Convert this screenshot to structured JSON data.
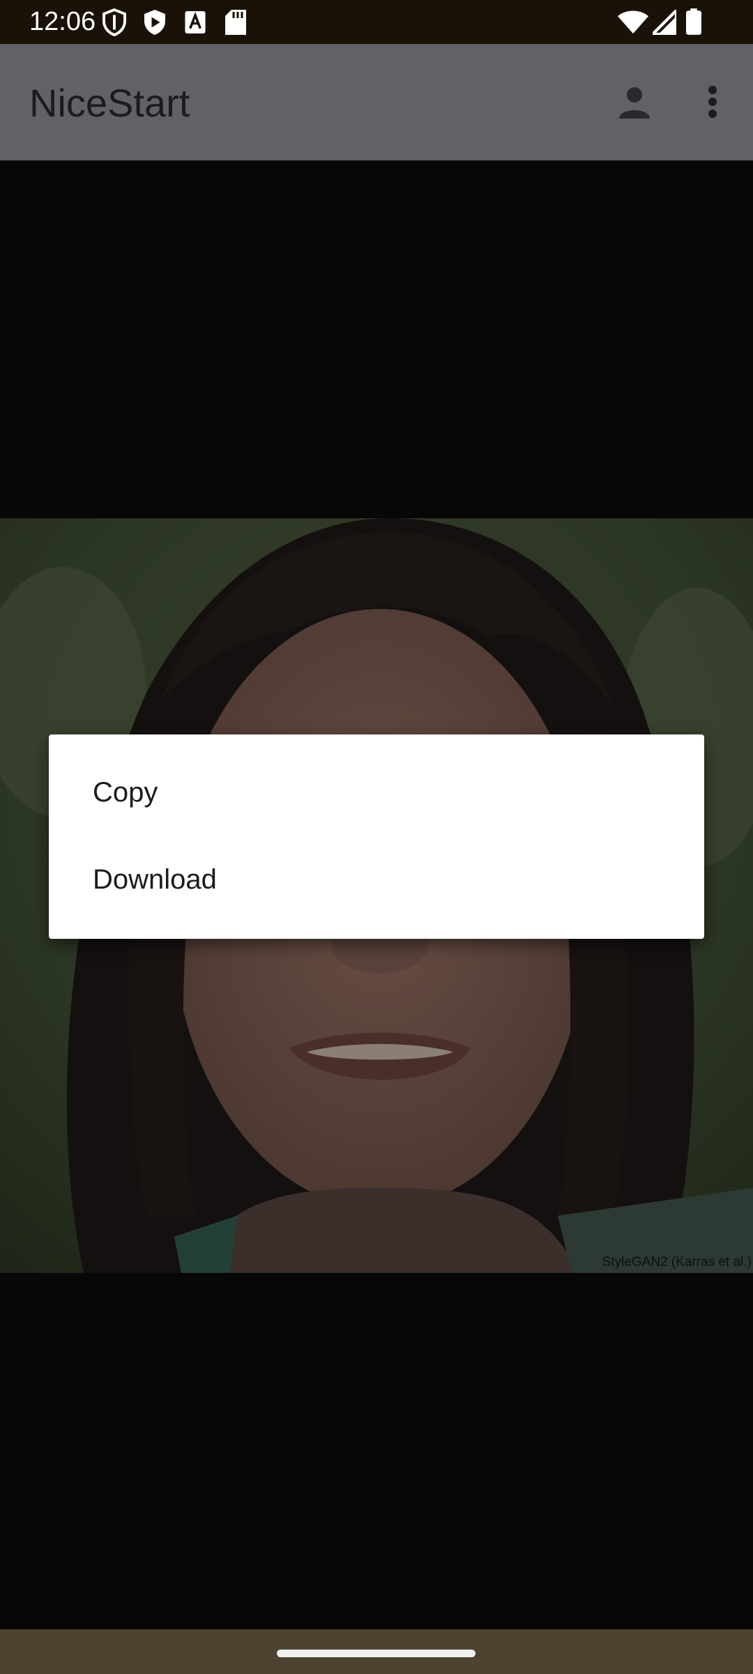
{
  "status_bar": {
    "time": "12:06",
    "left_icons": [
      "shield-icon",
      "play-protect-icon",
      "font-a-icon",
      "sd-card-icon"
    ],
    "right_icons": [
      "wifi-icon",
      "signal-icon",
      "battery-icon"
    ]
  },
  "app_bar": {
    "title": "NiceStart",
    "actions": [
      "account-icon",
      "more-vert-icon"
    ]
  },
  "photo": {
    "caption": "StyleGAN2 (Karras et al.)"
  },
  "dialog": {
    "items": [
      {
        "label": "Copy"
      },
      {
        "label": "Download"
      }
    ]
  },
  "colors": {
    "status_bar": "#1a1208",
    "app_bar_dimmed": "#626168",
    "background": "#070707",
    "nav_bar": "#4d4330"
  }
}
